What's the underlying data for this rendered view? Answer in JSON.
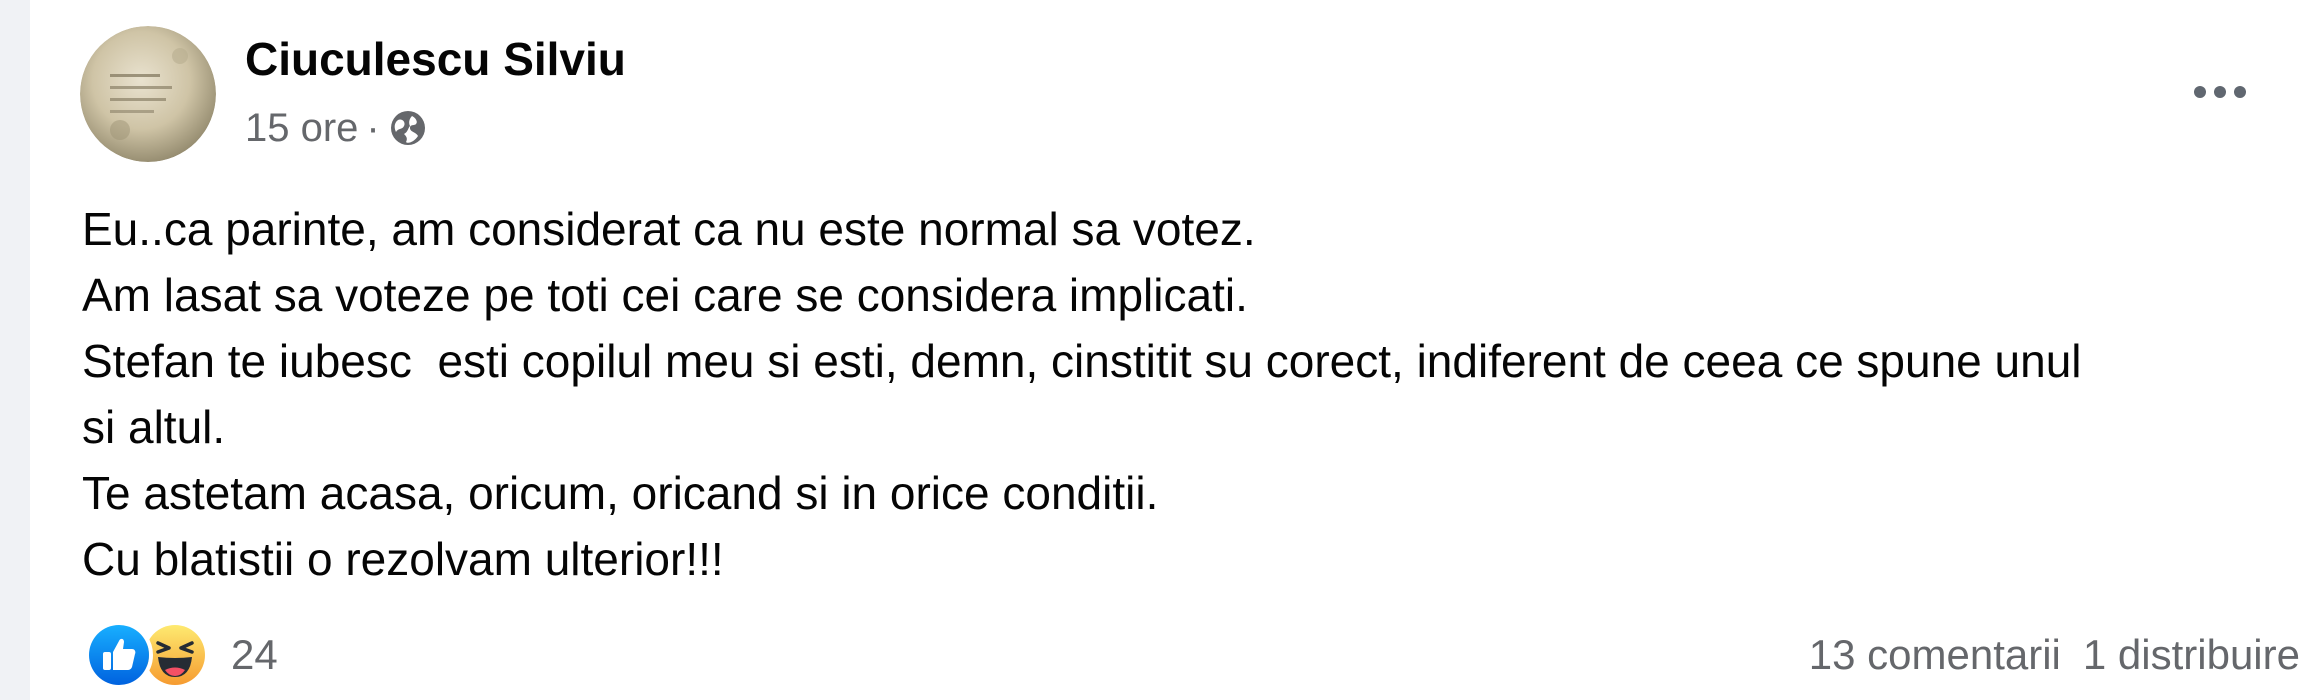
{
  "post": {
    "author": "Ciuculescu Silviu",
    "time": "15 ore",
    "separator": "·",
    "privacy_icon": "globe-icon",
    "more_icon": "more-horizontal-icon",
    "text_lines": [
      "Eu..ca parinte, am considerat ca nu este normal sa votez.",
      "Am lasat sa voteze pe toti cei care se considera implicati.",
      "Stefan te iubesc  esti copilul meu si esti, demn, cinstitit su corect, indiferent de ceea ce spune unul",
      "si altul.",
      "Te astetam acasa, oricum, oricand si in orice conditii.",
      "Cu blatistii o rezolvam ulterior!!!"
    ]
  },
  "footer": {
    "reaction_icons": [
      "like-icon",
      "haha-icon"
    ],
    "reaction_count": "24",
    "comments": "13 comentarii",
    "shares": "1 distribuire"
  },
  "colors": {
    "like_blue": "#1877f2",
    "haha_yellow": "#f7b928",
    "secondary_text": "#65676b",
    "primary_text": "#050505"
  }
}
